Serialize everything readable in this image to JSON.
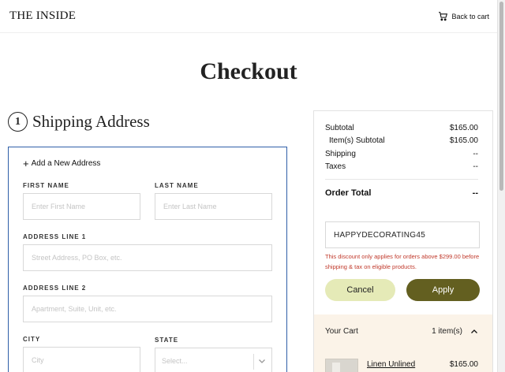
{
  "header": {
    "logo": "THE INSIDE",
    "back_label": "Back to cart"
  },
  "page": {
    "title": "Checkout"
  },
  "shipping": {
    "step_number": "1",
    "title": "Shipping Address",
    "add_new_label": "Add a New Address",
    "fields": {
      "first_name": {
        "label": "FIRST NAME",
        "placeholder": "Enter First Name"
      },
      "last_name": {
        "label": "LAST NAME",
        "placeholder": "Enter Last Name"
      },
      "address1": {
        "label": "ADDRESS LINE 1",
        "placeholder": "Street Address, PO Box, etc."
      },
      "address2": {
        "label": "ADDRESS LINE 2",
        "placeholder": "Apartment, Suite, Unit, etc."
      },
      "city": {
        "label": "CITY",
        "placeholder": "City"
      },
      "state": {
        "label": "STATE",
        "placeholder": "Select..."
      }
    }
  },
  "summary": {
    "subtotal_label": "Subtotal",
    "subtotal_value": "$165.00",
    "items_subtotal_label": "Item(s) Subtotal",
    "items_subtotal_value": "$165.00",
    "shipping_label": "Shipping",
    "shipping_value": "--",
    "taxes_label": "Taxes",
    "taxes_value": "--",
    "order_total_label": "Order Total",
    "order_total_value": "--",
    "promo_code_value": "HAPPYDECORATING45",
    "promo_error": "This discount only applies for orders above $299.00 before shipping & tax on eligible products.",
    "cancel_label": "Cancel",
    "apply_label": "Apply"
  },
  "cart": {
    "title": "Your Cart",
    "count": "1 item(s)",
    "item_name": "Linen Unlined",
    "item_price": "$165.00"
  },
  "colors": {
    "accent_olive": "#635f20",
    "light_olive": "#e5eab7",
    "cart_bg": "#fbf3e8",
    "error": "#c0392b",
    "focus_border": "#2f5fa8"
  }
}
